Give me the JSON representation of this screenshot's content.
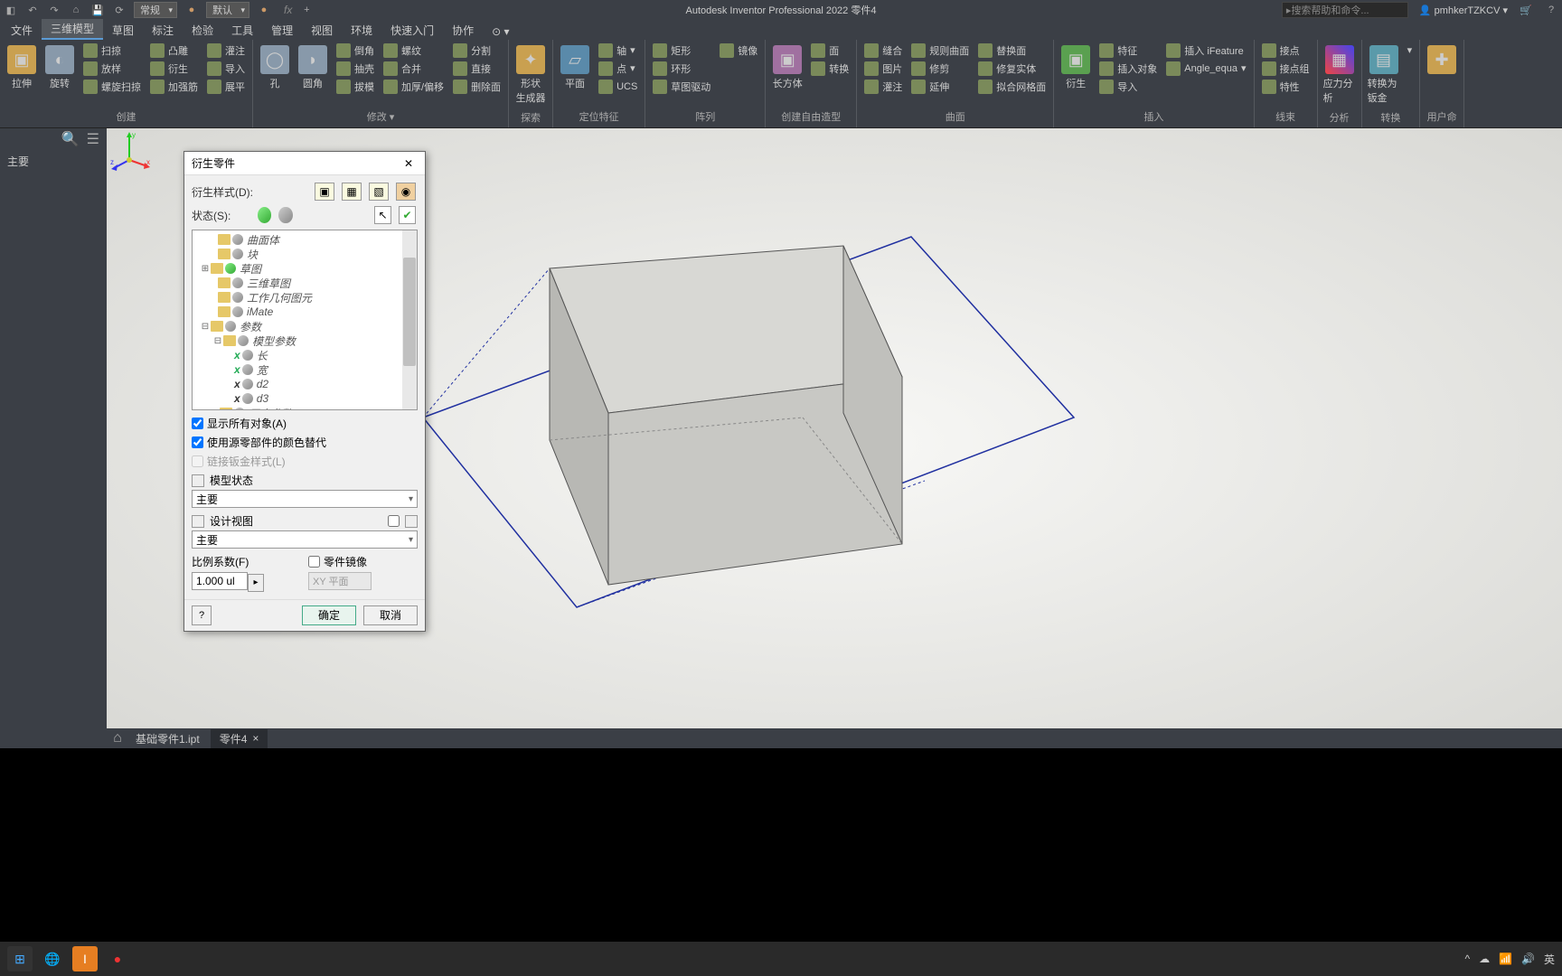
{
  "title_bar": {
    "app_title": "Autodesk Inventor Professional 2022  零件4",
    "view_dropdown": "常规",
    "appearance_dropdown": "默认",
    "search_placeholder": "搜索帮助和命令...",
    "username": "pmhkerTZKCV"
  },
  "ribbon_tabs": {
    "active": "三维模型",
    "tabs": [
      "文件",
      "三维模型",
      "草图",
      "标注",
      "检验",
      "工具",
      "管理",
      "视图",
      "环境",
      "快速入门",
      "协作"
    ]
  },
  "ribbon": {
    "panels": {
      "create": {
        "label": "创建",
        "extrude": "拉伸",
        "revolve": "旋转",
        "sweep": "扫掠",
        "loft": "放样",
        "derive": "衍生",
        "coil": "螺旋扫掠",
        "emboss": "凸雕",
        "import": "导入",
        "unwrap": "展平",
        "rib": "加强筋"
      },
      "modify": {
        "label": "修改 ▾",
        "hole": "孔",
        "fillet": "圆角",
        "chamfer": "倒角",
        "shell": "抽壳",
        "draft": "拔模",
        "thread": "螺纹",
        "combine": "合并",
        "thicken": "加厚/偏移",
        "split": "分割",
        "direct": "直接",
        "delete": "删除面"
      },
      "explore": {
        "label": "探索",
        "shape_gen": "形状\n生成器"
      },
      "work": {
        "label": "定位特征",
        "plane": "平面",
        "axis": "轴",
        "point": "点",
        "ucs": "UCS"
      },
      "pattern": {
        "label": "阵列",
        "rect": "矩形",
        "circ": "环形",
        "sketch_driven": "草图驱动",
        "mirror": "镜像"
      },
      "freeform": {
        "label": "创建自由造型",
        "box": "长方体",
        "convert": "转换",
        "face": "面",
        "image": "图片",
        "decal": "灌注",
        "shear": "修剪",
        "extend": "延伸",
        "ruled": "规则曲面",
        "replace": "替换面",
        "repair": "修复实体",
        "fit_mesh": "拟合网格面",
        "stitch": "缝合"
      },
      "surface": {
        "label": "曲面",
        "derive_surf": "衍生"
      },
      "insert": {
        "label": "插入",
        "feature": "特征",
        "insert_obj": "插入对象",
        "import_cmd": "导入",
        "insert_ifeature": "插入 iFeature",
        "angle_equal": "Angle_equa"
      },
      "harness": {
        "label": "线束",
        "point": "接点",
        "point_group": "接点组",
        "properties": "特性"
      },
      "analysis": {
        "label": "分析",
        "stress": "应力分析"
      },
      "convert": {
        "label": "转换",
        "sheet_metal": "转换为钣金"
      },
      "user": {
        "label": "用户命"
      }
    }
  },
  "browser": {
    "header": "主要"
  },
  "dialog": {
    "title": "衍生零件",
    "style_label": "衍生样式(D):",
    "status_label": "状态(S):",
    "tree": {
      "n1": "曲面体",
      "n2": "块",
      "n3": "草图",
      "n4": "三维草图",
      "n5": "工作几何图元",
      "n6": "iMate",
      "n7": "参数",
      "n8": "模型参数",
      "p1": "长",
      "p2": "宽",
      "p3": "d2",
      "p4": "d3",
      "n9": "用户参数"
    },
    "check1": "显示所有对象(A)",
    "check2": "使用源零部件的颜色替代",
    "check3": "链接钣金样式(L)",
    "model_state": "模型状态",
    "design_view": "设计视图",
    "combo_value": "主要",
    "scale_label": "比例系数(F)",
    "scale_value": "1.000 ul",
    "mirror_label": "零件镜像",
    "mirror_plane": "XY 平面",
    "ok": "确定",
    "cancel": "取消"
  },
  "doc_tabs": {
    "tab1": "基础零件1.ipt",
    "tab2": "零件4"
  },
  "taskbar": {
    "ime": "英"
  }
}
